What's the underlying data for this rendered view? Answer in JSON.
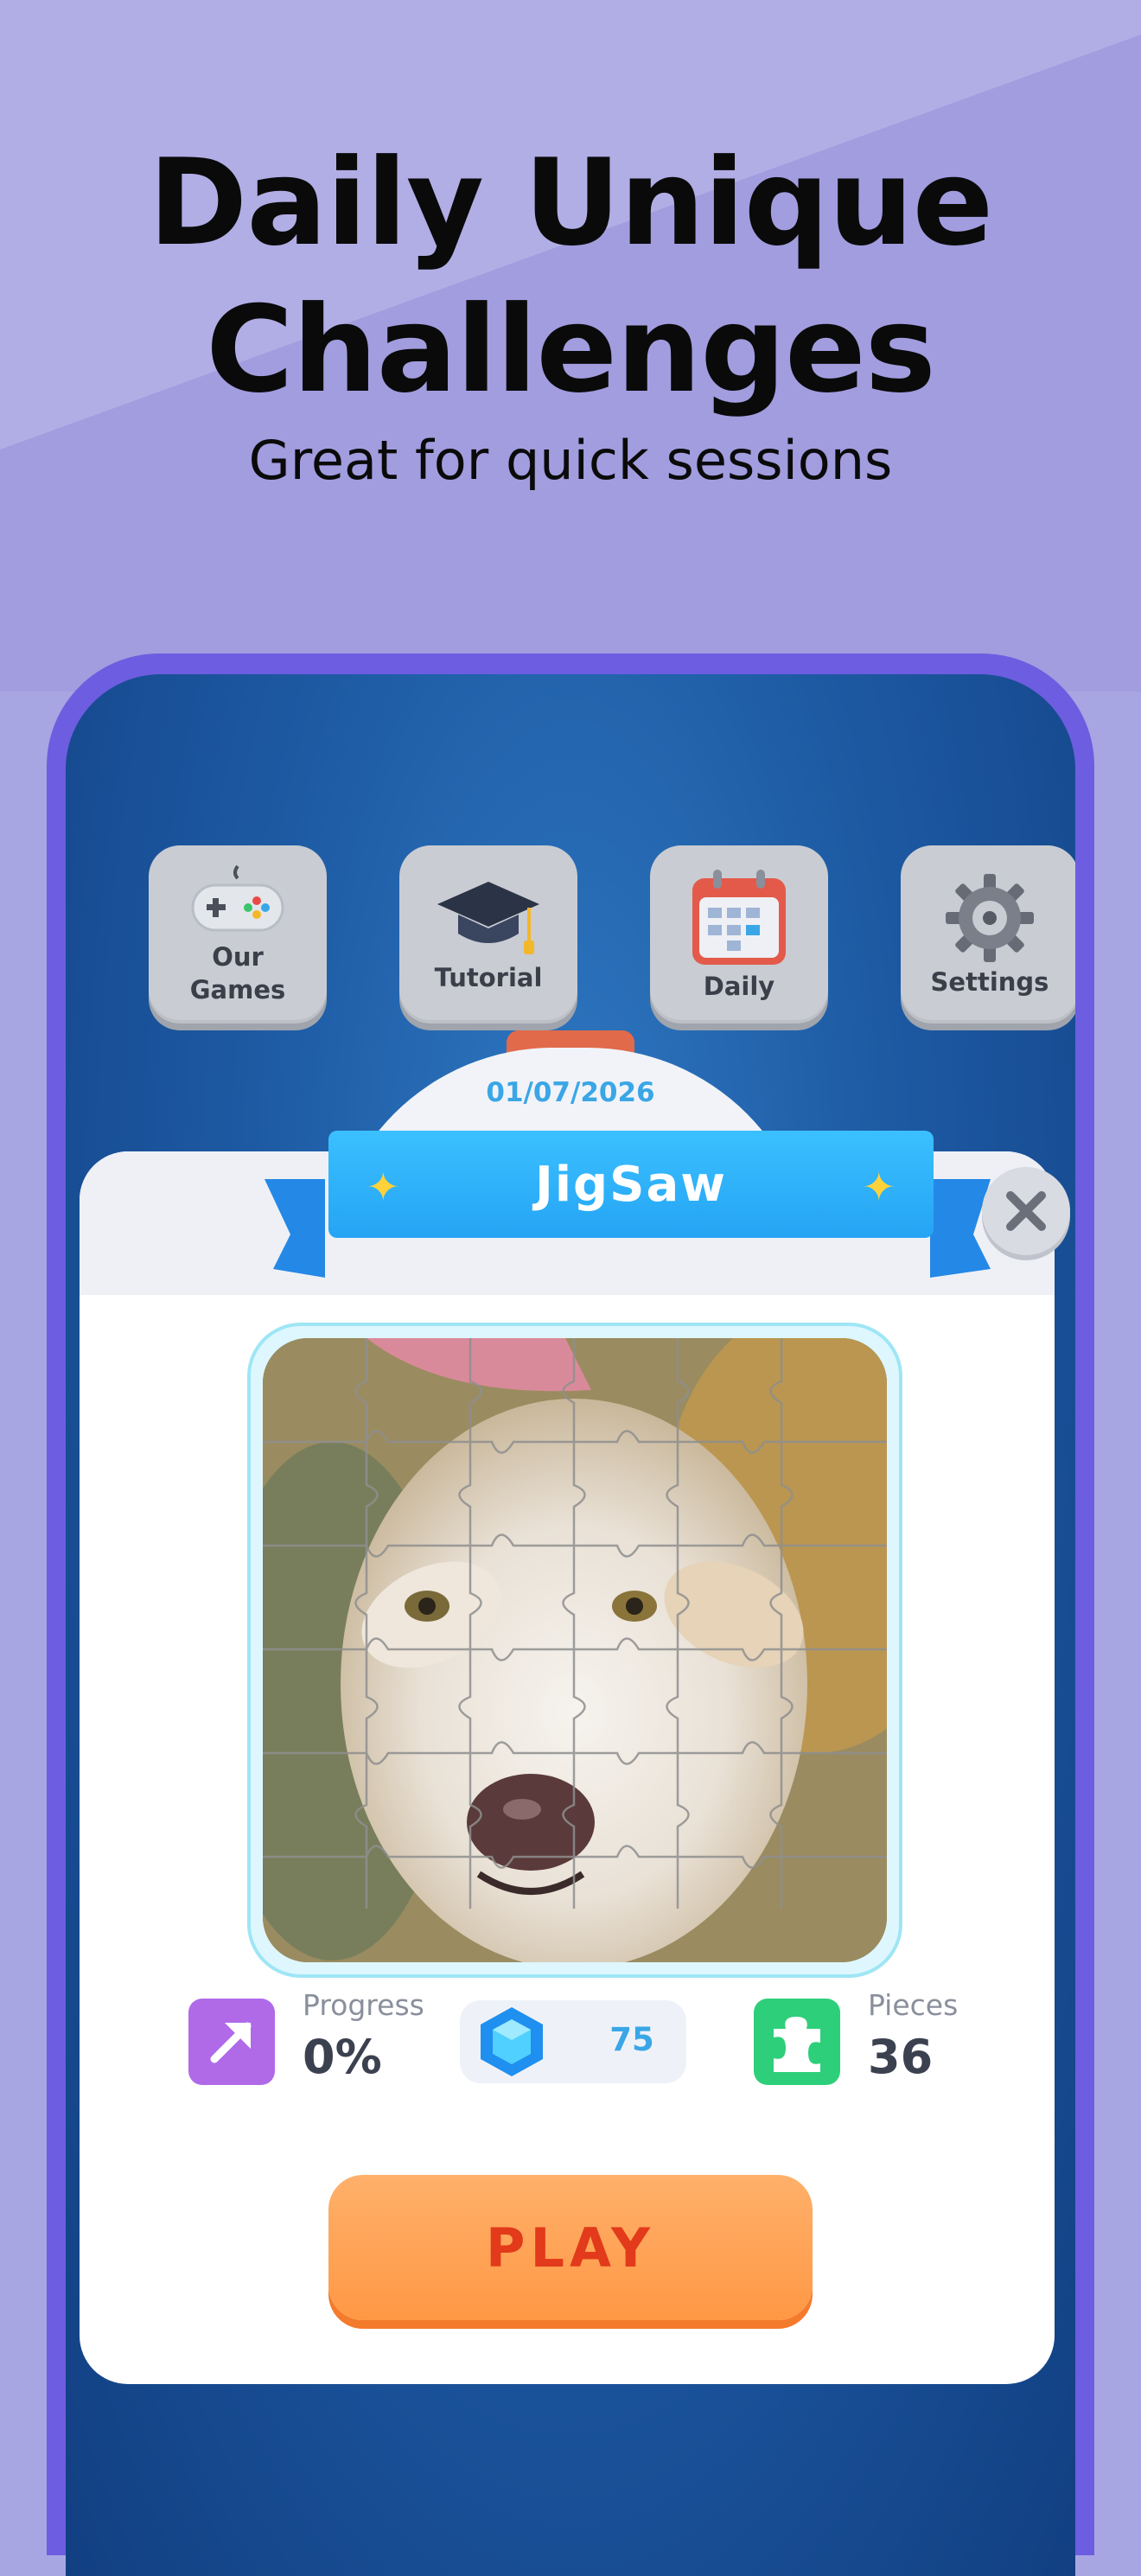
{
  "marketing": {
    "title_line1": "Daily Unique",
    "title_line2": "Challenges",
    "subtitle": "Great for quick sessions"
  },
  "menu": [
    {
      "label_line1": "Our",
      "label_line2": "Games",
      "icon": "gamepad-icon"
    },
    {
      "label_line1": "Tutorial",
      "icon": "graduation-cap-icon"
    },
    {
      "label_line1": "Daily",
      "icon": "calendar-icon"
    },
    {
      "label_line1": "Settings",
      "icon": "gear-icon"
    }
  ],
  "daily": {
    "date": "01/07/2026",
    "title": "JigSaw",
    "puzzle_image": "dog-puzzle-image"
  },
  "stats": {
    "progress_label": "Progress",
    "progress_value": "0%",
    "gems": "75",
    "pieces_label": "Pieces",
    "pieces_value": "36"
  },
  "actions": {
    "play_label": "PLAY",
    "close_icon": "close-icon"
  },
  "colors": {
    "accent_blue": "#25a4f4",
    "play_orange": "#ff9845",
    "play_text": "#e23a1a",
    "phone_frame": "#6d5de0"
  }
}
